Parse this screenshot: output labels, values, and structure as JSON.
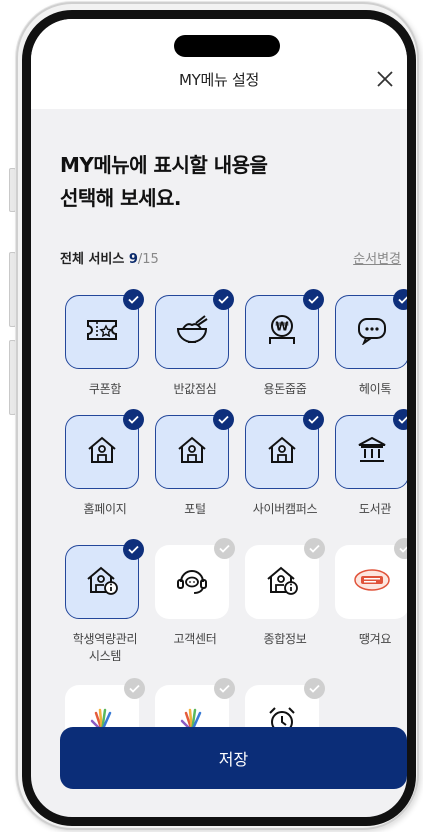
{
  "header": {
    "title": "MY메뉴 설정",
    "close_icon": "close-icon"
  },
  "intro": {
    "line1": "MY메뉴에 표시할 내용을",
    "line2": "선택해 보세요."
  },
  "services": {
    "label": "전체 서비스",
    "selected": "9",
    "total": "/15",
    "reorder": "순서변경"
  },
  "tiles": [
    {
      "label": "쿠폰함",
      "icon": "coupon-icon",
      "selected": true
    },
    {
      "label": "반값점심",
      "icon": "rice-bowl-icon",
      "selected": true
    },
    {
      "label": "용돈줍줍",
      "icon": "won-coin-icon",
      "selected": true
    },
    {
      "label": "헤이톡",
      "icon": "chat-bubble-icon",
      "selected": true
    },
    {
      "label": "홈페이지",
      "icon": "house-icon",
      "selected": true
    },
    {
      "label": "포털",
      "icon": "house-icon",
      "selected": true
    },
    {
      "label": "사이버캠퍼스",
      "icon": "house-icon",
      "selected": true
    },
    {
      "label": "도서관",
      "icon": "library-icon",
      "selected": true
    },
    {
      "label": "학생역량관리",
      "label2": "시스템",
      "icon": "house-info-icon",
      "selected": true
    },
    {
      "label": "고객센터",
      "icon": "headset-icon",
      "selected": false
    },
    {
      "label": "종합정보",
      "icon": "house-info-icon",
      "selected": false
    },
    {
      "label": "땡겨요",
      "icon": "ttaenggyeoyo-logo-icon",
      "selected": false
    },
    {
      "label": "",
      "icon": "hand-logo-icon",
      "selected": false
    },
    {
      "label": "",
      "icon": "hand-logo-icon",
      "selected": false
    },
    {
      "label": "",
      "icon": "alarm-clock-icon",
      "selected": false
    }
  ],
  "save": {
    "label": "저장"
  },
  "colors": {
    "primary": "#0b2d78",
    "selected_bg": "#d9e6fb",
    "check_off": "#cfcfcf"
  }
}
